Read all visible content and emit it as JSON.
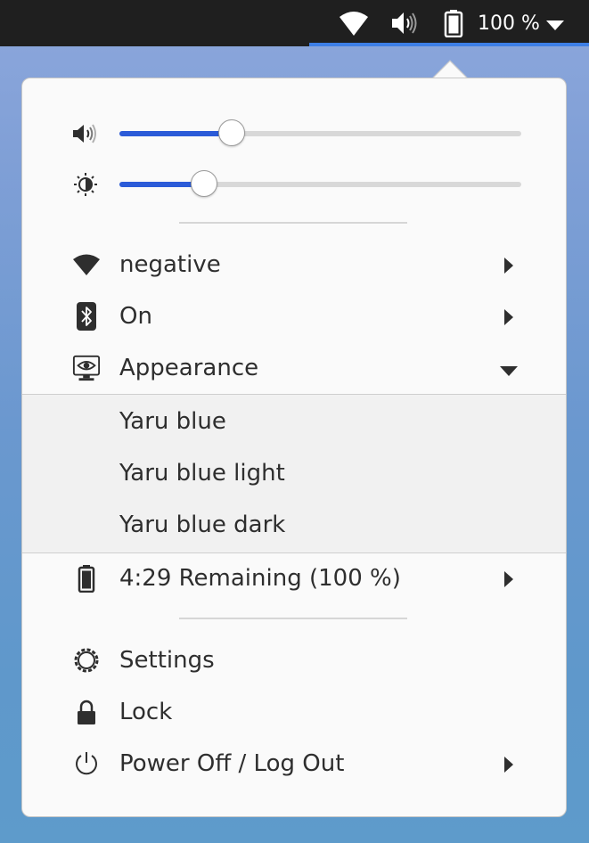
{
  "topbar": {
    "battery_text": "100 %",
    "icons": [
      "wifi-icon",
      "volume-icon",
      "battery-icon",
      "menu-arrow-down-icon"
    ]
  },
  "sliders": {
    "volume": {
      "icon": "volume-icon",
      "level_percent": 28
    },
    "brightness": {
      "icon": "brightness-icon",
      "level_percent": 21
    }
  },
  "items": {
    "wifi": {
      "icon": "wifi-icon",
      "label": "negative"
    },
    "bluetooth": {
      "icon": "bluetooth-icon",
      "label": "On"
    },
    "appearance": {
      "icon": "appearance-icon",
      "label": "Appearance"
    },
    "battery": {
      "icon": "battery-icon",
      "label": "4:29 Remaining (100 %)"
    },
    "settings": {
      "icon": "gear-icon",
      "label": "Settings"
    },
    "lock": {
      "icon": "lock-icon",
      "label": "Lock"
    },
    "power": {
      "icon": "power-icon",
      "label": "Power Off / Log Out"
    }
  },
  "appearance_options": [
    "Yaru blue",
    "Yaru blue light",
    "Yaru blue dark"
  ],
  "colors": {
    "accent": "#2b5bd8",
    "topbar": "#1f1f1f",
    "menu_background": "#fafafa",
    "submenu_background": "#f1f1f1",
    "text": "#2e2e2e"
  }
}
